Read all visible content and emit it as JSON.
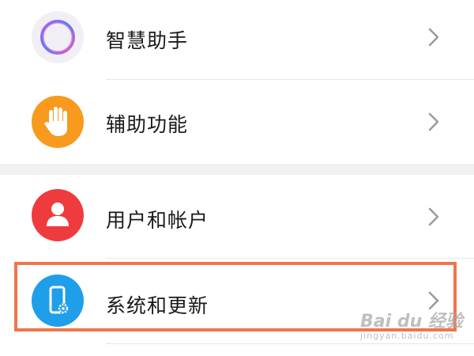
{
  "settings_list": {
    "items": [
      {
        "label": "智慧助手",
        "icon": "smart-assistant-ring-icon"
      },
      {
        "label": "辅助功能",
        "icon": "hand-icon",
        "color": "#f79a1e"
      },
      {
        "label": "用户和帐户",
        "icon": "user-icon",
        "color": "#ef3b3e"
      },
      {
        "label": "系统和更新",
        "icon": "phone-gear-icon",
        "color": "#1f9eea"
      }
    ],
    "highlighted_item": "系统和更新",
    "highlight_color": "#ef7549"
  },
  "watermark": {
    "top": "Bai du 经验",
    "bottom": "jingyan.baidu.com"
  }
}
